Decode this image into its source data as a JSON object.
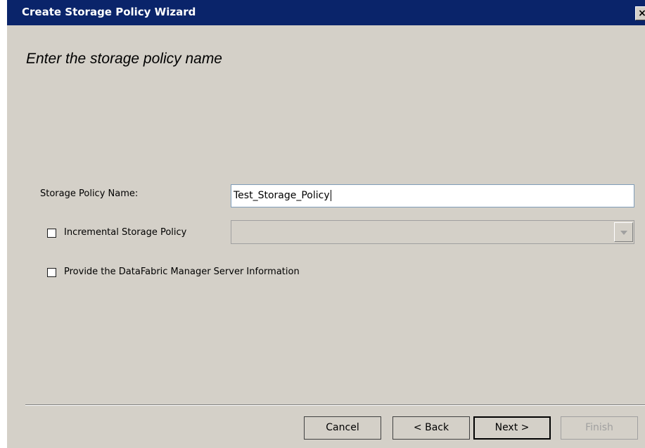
{
  "window": {
    "title": "Create Storage Policy Wizard",
    "close_glyph": "×"
  },
  "page": {
    "heading": "Enter the storage policy name"
  },
  "form": {
    "policy_name_label": "Storage Policy Name:",
    "policy_name_value": "Test_Storage_Policy",
    "incremental_label": "Incremental Storage Policy",
    "incremental_checked": false,
    "incremental_select_value": "",
    "dfm_label": "Provide the DataFabric Manager Server Information",
    "dfm_checked": false
  },
  "buttons": {
    "cancel": "Cancel",
    "back": "< Back",
    "next": "Next >",
    "finish": "Finish"
  },
  "colors": {
    "titlebar": "#0a246a",
    "dialog_bg": "#d4d0c8",
    "disabled_text": "#a0a0a0"
  }
}
